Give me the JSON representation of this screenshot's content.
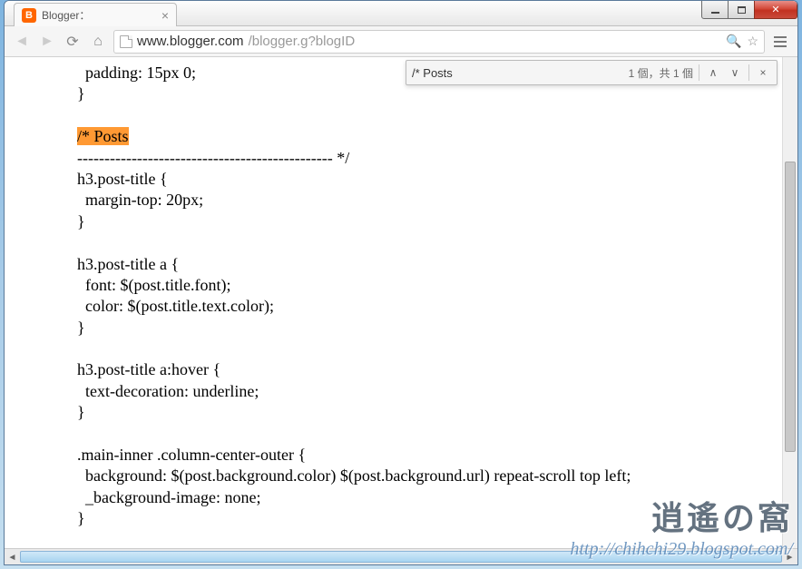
{
  "window": {
    "tab_title": "Blogger：",
    "favicon_letter": "B"
  },
  "address": {
    "host": "www.blogger.com",
    "path": "/blogger.g?blogID"
  },
  "findbar": {
    "query": "/* Posts",
    "count_text": "1 個，共 1 個"
  },
  "code": {
    "l1": "  padding: 15px 0;",
    "l2": "}",
    "hl": "/* Posts",
    "dash": "----------------------------------------------- */",
    "r1a": "h3.post-title {",
    "r1b": "  margin-top: 20px;",
    "r1c": "}",
    "r2a": "h3.post-title a {",
    "r2b": "  font: $(post.title.font);",
    "r2c": "  color: $(post.title.text.color);",
    "r2d": "}",
    "r3a": "h3.post-title a:hover {",
    "r3b": "  text-decoration: underline;",
    "r3c": "}",
    "r4a": ".main-inner .column-center-outer {",
    "r4b": "  background: $(post.background.color) $(post.background.url) repeat-scroll top left;",
    "r4c": "  _background-image: none;",
    "r4d": "}"
  },
  "watermark": {
    "title": "逍遙の窩",
    "url": "http://chihchi29.blogspot.com/"
  }
}
